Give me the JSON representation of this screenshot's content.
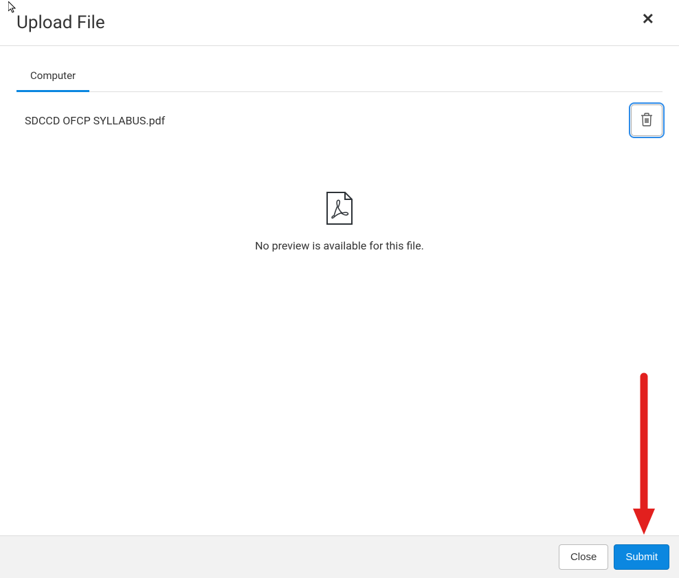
{
  "header": {
    "title": "Upload File"
  },
  "tabs": {
    "computer": "Computer"
  },
  "file": {
    "name": "SDCCD OFCP SYLLABUS.pdf"
  },
  "preview": {
    "message": "No preview is available for this file."
  },
  "footer": {
    "close_label": "Close",
    "submit_label": "Submit"
  }
}
